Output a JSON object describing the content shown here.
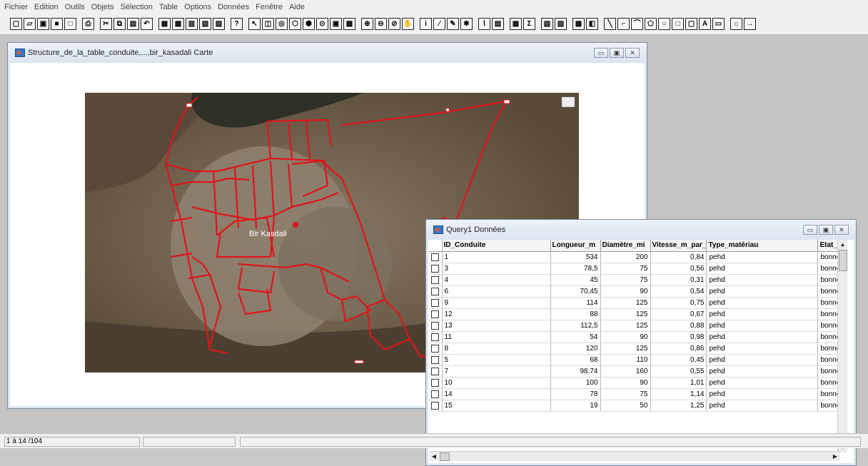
{
  "menubar": [
    "Fichier",
    "Edition",
    "Outils",
    "Objets",
    "Sélection",
    "Table",
    "Options",
    "Données",
    "Fenêtre",
    "Aide"
  ],
  "map_window": {
    "title": "Structure_de_la_table_conduite,...,bir_kasadali Carte",
    "place_label": "Bir Kasdali"
  },
  "data_window": {
    "title": "Query1 Données",
    "columns": [
      "ID_Conduite",
      "Longueur_m",
      "Diamètre_mi",
      "Vitesse_m_par_",
      "Type_matériau",
      "Etat_c"
    ],
    "rows": [
      [
        "1",
        "534",
        "200",
        "0,84",
        "pehd",
        "bonne"
      ],
      [
        "3",
        "78,5",
        "75",
        "0,56",
        "pehd",
        "bonne"
      ],
      [
        "4",
        "45",
        "75",
        "0,31",
        "pehd",
        "bonne"
      ],
      [
        "6",
        "70,45",
        "90",
        "0,54",
        "pehd",
        "bonne"
      ],
      [
        "9",
        "114",
        "125",
        "0,75",
        "pehd",
        "bonne"
      ],
      [
        "12",
        "88",
        "125",
        "0,67",
        "pehd",
        "bonne"
      ],
      [
        "13",
        "112,5",
        "125",
        "0,88",
        "pehd",
        "bonne"
      ],
      [
        "11",
        "54",
        "90",
        "0,98",
        "pehd",
        "bonne"
      ],
      [
        "8",
        "120",
        "125",
        "0,86",
        "pehd",
        "bonne"
      ],
      [
        "5",
        "68",
        "110",
        "0,45",
        "pehd",
        "bonne"
      ],
      [
        "7",
        "98,74",
        "160",
        "0,55",
        "pehd",
        "bonne"
      ],
      [
        "10",
        "100",
        "90",
        "1,01",
        "pehd",
        "bonne"
      ],
      [
        "14",
        "78",
        "75",
        "1,14",
        "pehd",
        "bonne"
      ],
      [
        "15",
        "19",
        "50",
        "1,25",
        "pehd",
        "bonne"
      ]
    ]
  },
  "status": {
    "record_count": "1 à 14 /104"
  },
  "colors": {
    "pipe_network": "#e0141a",
    "satellite_ground": "#6b5a45"
  }
}
